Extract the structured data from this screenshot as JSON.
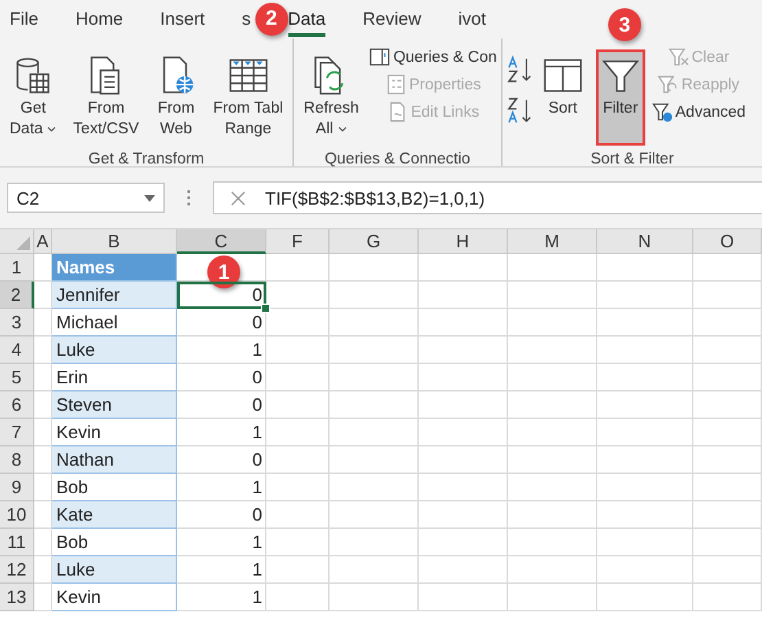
{
  "ribbon_tabs": [
    {
      "label": "File",
      "selected": false
    },
    {
      "label": "Home",
      "selected": false
    },
    {
      "label": "Insert",
      "selected": false
    },
    {
      "label": "s",
      "selected": false
    },
    {
      "label": "Data",
      "selected": true,
      "callout": "2"
    },
    {
      "label": "Review",
      "selected": false
    },
    {
      "label": "ivot",
      "selected": false
    }
  ],
  "ribbon_groups": [
    {
      "label": "Get & Transform",
      "items": [
        {
          "kind": "large",
          "lines": [
            "Get",
            "Data"
          ],
          "dropdown": true
        },
        {
          "kind": "large",
          "lines": [
            "From",
            "Text/CSV"
          ]
        },
        {
          "kind": "large",
          "lines": [
            "From",
            "Web"
          ]
        },
        {
          "kind": "large",
          "lines": [
            "From Tabl",
            "Range"
          ]
        }
      ]
    },
    {
      "label": "Queries & Connectio",
      "items": [
        {
          "kind": "large",
          "lines": [
            "Refresh",
            "All"
          ],
          "dropdown": true
        },
        {
          "kind": "small",
          "label": "Queries & Con",
          "disabled": false
        },
        {
          "kind": "small",
          "label": "Properties",
          "disabled": true
        },
        {
          "kind": "small",
          "label": "Edit Links",
          "disabled": true
        }
      ]
    },
    {
      "label": "Sort & Filter",
      "items": [
        {
          "kind": "icon"
        },
        {
          "kind": "icon"
        },
        {
          "kind": "large",
          "lines": [
            "Sort"
          ]
        },
        {
          "kind": "large",
          "lines": [
            "Filter"
          ],
          "selected": true,
          "callout": "3"
        },
        {
          "kind": "small",
          "label": "Clear",
          "disabled": true
        },
        {
          "kind": "small",
          "label": "Reapply",
          "disabled": true
        },
        {
          "kind": "small",
          "label": "Advanced",
          "disabled": false
        }
      ]
    }
  ],
  "name_box": "C2",
  "formula": "TIF($B$2:$B$13,B2)=1,0,1)",
  "columns": [
    {
      "label": "A",
      "selected": false
    },
    {
      "label": "B",
      "selected": false
    },
    {
      "label": "C",
      "selected": true,
      "callout": "1"
    },
    {
      "label": "F",
      "selected": false
    },
    {
      "label": "G",
      "selected": false
    },
    {
      "label": "H",
      "selected": false
    },
    {
      "label": "M",
      "selected": false
    },
    {
      "label": "N",
      "selected": false
    },
    {
      "label": "O",
      "selected": false
    }
  ],
  "rows": [
    {
      "number": "1",
      "selected": false,
      "kind": "header",
      "b": "Names"
    },
    {
      "number": "2",
      "selected": true,
      "b": "Jennifer",
      "c": "0"
    },
    {
      "number": "3",
      "selected": false,
      "b": "Michael",
      "c": "0"
    },
    {
      "number": "4",
      "selected": false,
      "b": "Luke",
      "c": "1"
    },
    {
      "number": "5",
      "selected": false,
      "b": "Erin",
      "c": "0"
    },
    {
      "number": "6",
      "selected": false,
      "b": "Steven",
      "c": "0"
    },
    {
      "number": "7",
      "selected": false,
      "b": "Kevin",
      "c": "1"
    },
    {
      "number": "8",
      "selected": false,
      "b": "Nathan",
      "c": "0"
    },
    {
      "number": "9",
      "selected": false,
      "b": "Bob",
      "c": "1"
    },
    {
      "number": "10",
      "selected": false,
      "b": "Kate",
      "c": "0"
    },
    {
      "number": "11",
      "selected": false,
      "b": "Bob",
      "c": "1"
    },
    {
      "number": "12",
      "selected": false,
      "b": "Luke",
      "c": "1"
    },
    {
      "number": "13",
      "selected": false,
      "b": "Kevin",
      "c": "1"
    }
  ]
}
